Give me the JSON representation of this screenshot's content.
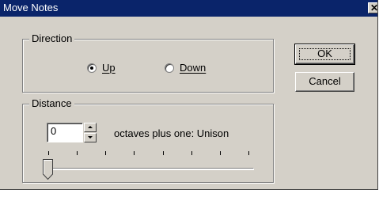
{
  "window": {
    "title": "Move Notes",
    "close_glyph": "✕"
  },
  "direction": {
    "legend": "Direction",
    "options": [
      {
        "label": "Up",
        "checked": true
      },
      {
        "label": "Down",
        "checked": false
      }
    ]
  },
  "buttons": {
    "ok": "OK",
    "cancel": "Cancel"
  },
  "distance": {
    "legend": "Distance",
    "octaves_value": "0",
    "label": "octaves plus one:  Unison",
    "slider": {
      "min": 0,
      "max": 7,
      "value": 0,
      "tick_count": 8
    }
  },
  "icons": [
    "close-icon",
    "spin-up-icon",
    "spin-down-icon",
    "slider-thumb-icon"
  ]
}
